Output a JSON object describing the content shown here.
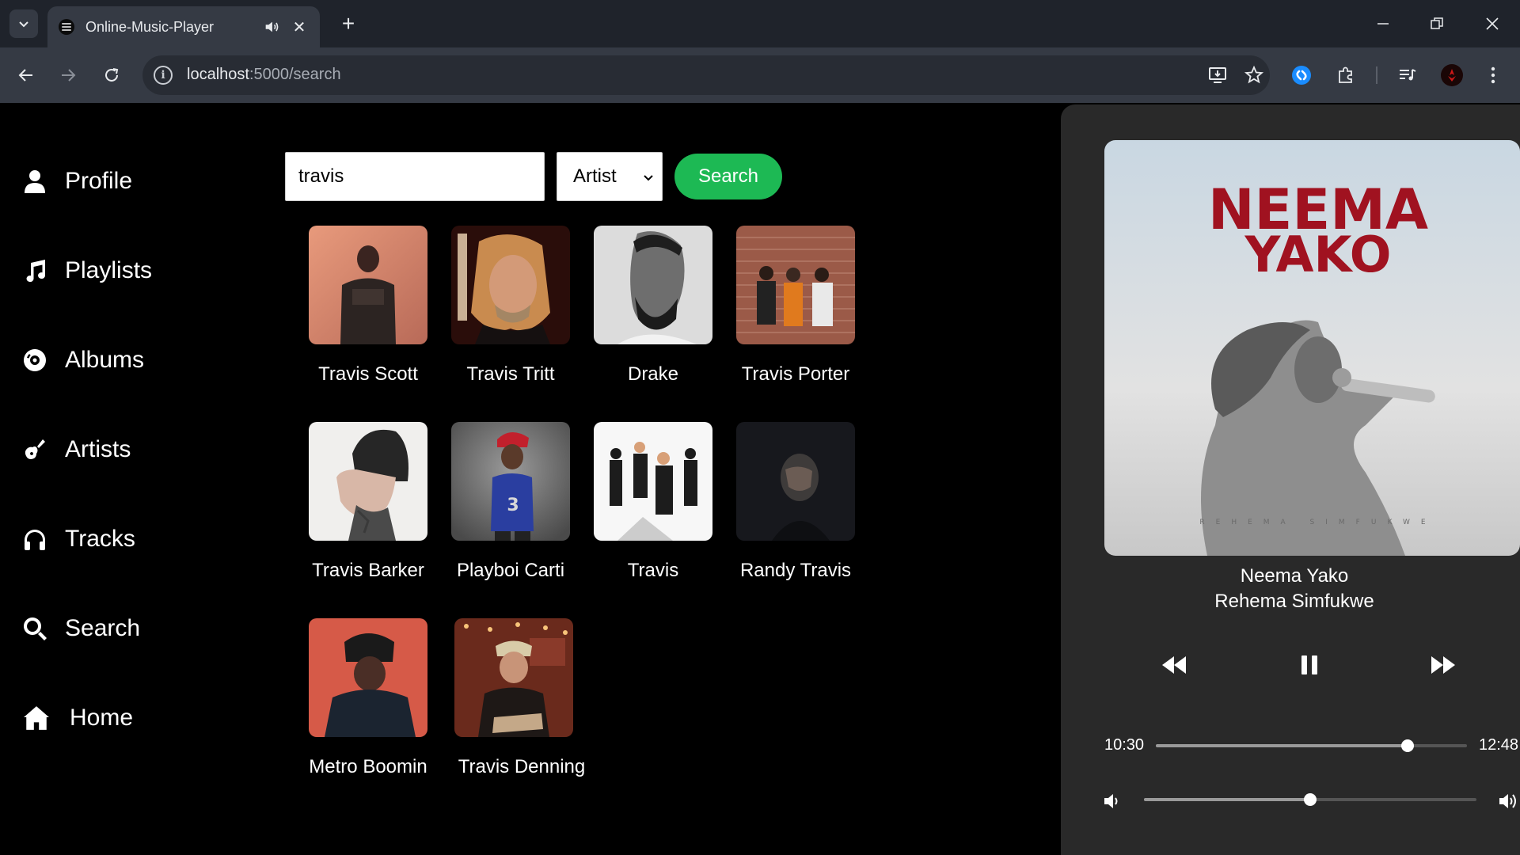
{
  "browser": {
    "tab_title": "Online-Music-Player",
    "url_host": "localhost",
    "url_rest": ":5000/search"
  },
  "sidebar": {
    "items": [
      {
        "label": "Profile",
        "icon": "user-icon"
      },
      {
        "label": "Playlists",
        "icon": "music-note-icon"
      },
      {
        "label": "Albums",
        "icon": "disc-icon"
      },
      {
        "label": "Artists",
        "icon": "guitar-icon"
      },
      {
        "label": "Tracks",
        "icon": "headphones-icon"
      },
      {
        "label": "Search",
        "icon": "search-icon"
      },
      {
        "label": "Home",
        "icon": "home-icon"
      }
    ]
  },
  "search": {
    "query": "travis",
    "type_selected": "Artist",
    "button_label": "Search"
  },
  "results": [
    {
      "name": "Travis Scott"
    },
    {
      "name": "Travis Tritt"
    },
    {
      "name": "Drake"
    },
    {
      "name": "Travis Porter"
    },
    {
      "name": "Travis Barker"
    },
    {
      "name": "Playboi Carti"
    },
    {
      "name": "Travis"
    },
    {
      "name": "Randy Travis"
    },
    {
      "name": "Metro Boomin"
    },
    {
      "name": "Travis Denning"
    }
  ],
  "player": {
    "cover_title_line1": "NEEMA",
    "cover_title_line2": "YAKO",
    "cover_artist_caption": "REHEMA SIMFUKWE",
    "track_title": "Neema Yako",
    "track_artist": "Rehema Simfukwe",
    "elapsed": "10:30",
    "duration": "12:48",
    "progress_fraction": 0.81,
    "volume_fraction": 0.5
  },
  "colors": {
    "accent": "#1db954",
    "page_bg": "#000000",
    "player_bg": "#292929",
    "chrome_dark": "#1f232b",
    "chrome_light": "#353a44"
  }
}
